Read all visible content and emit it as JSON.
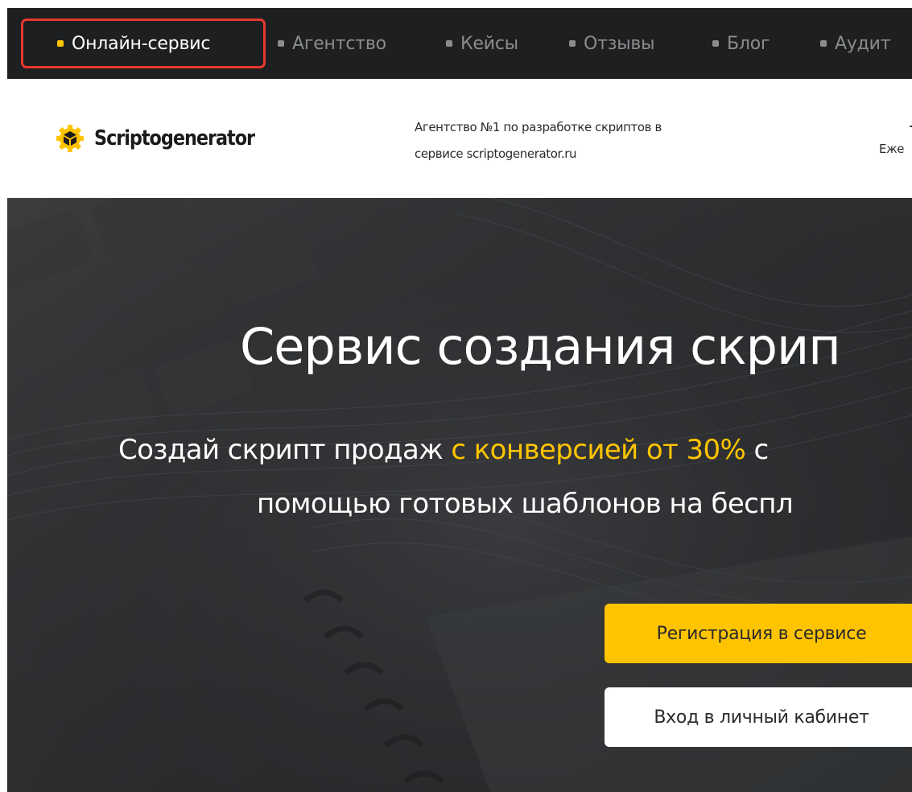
{
  "topnav": {
    "items": [
      {
        "label": "Онлайн-сервис",
        "active": true
      },
      {
        "label": "Агентство",
        "active": false
      },
      {
        "label": "Кейсы",
        "active": false
      },
      {
        "label": "Отзывы",
        "active": false
      },
      {
        "label": "Блог",
        "active": false
      },
      {
        "label": "Аудит",
        "active": false
      }
    ]
  },
  "header": {
    "logo_text": "Scriptogenerator",
    "tagline_line1": "Агентство №1 по разработке скриптов в",
    "tagline_line2": "сервисе scriptogenerator.ru",
    "right_text": "Еже"
  },
  "hero": {
    "title": "Сервис создания скрип",
    "sub_line1_pre": "Создай скрипт продаж ",
    "sub_line1_highlight": "с конверсией от 30%",
    "sub_line1_post": " с",
    "sub_line2": "помощью готовых шаблонов на беспл",
    "register_label": "Регистрация в сервисе",
    "login_label": "Вход в личный кабинет"
  },
  "colors": {
    "accent": "#ffc400",
    "nav_bg": "#1e1f20",
    "highlight_box": "#e8372e"
  }
}
